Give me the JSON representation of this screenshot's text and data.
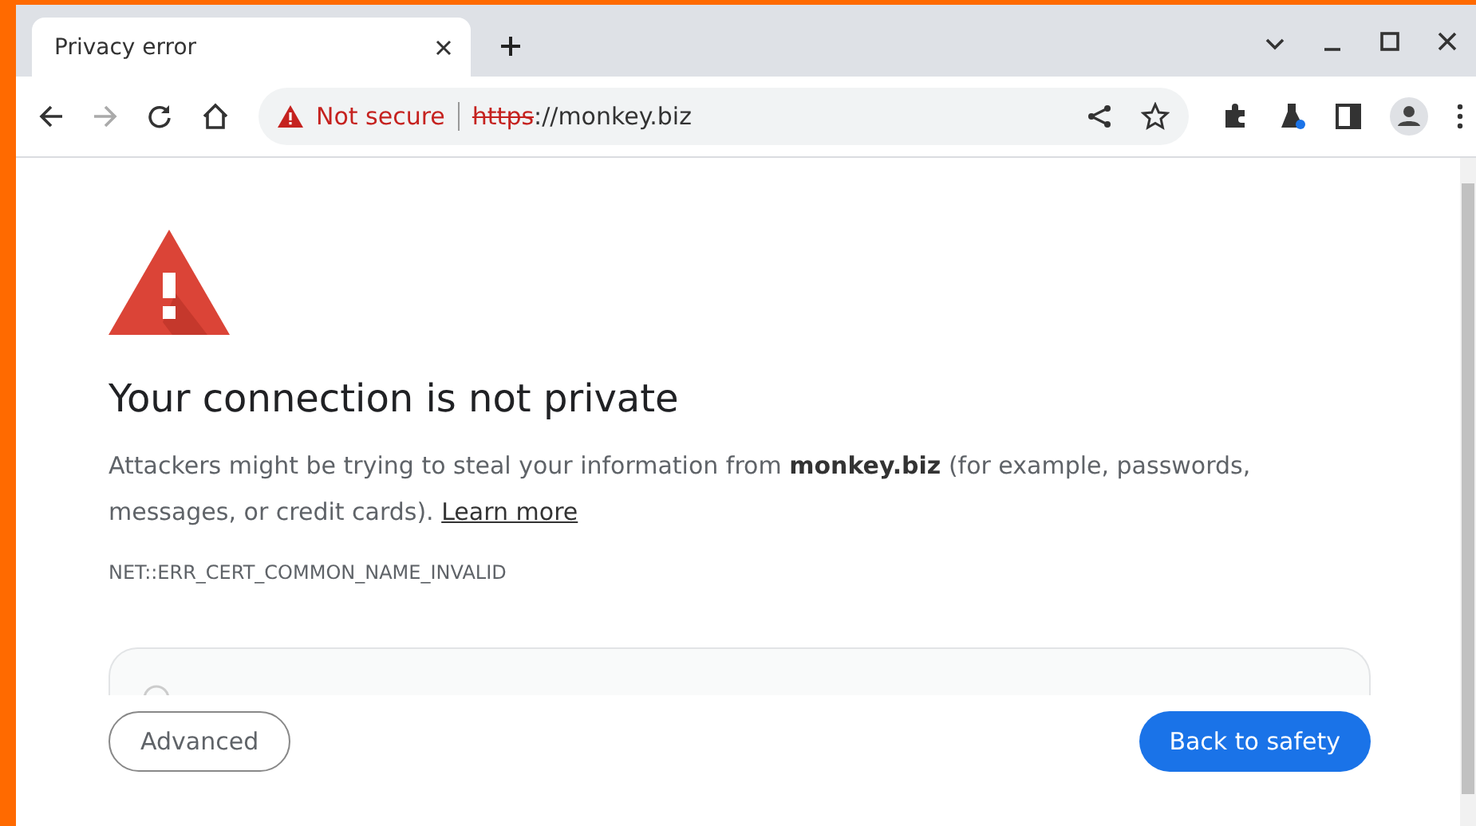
{
  "tab": {
    "title": "Privacy error",
    "selected": true
  },
  "toolbar": {
    "security_label": "Not secure",
    "url_scheme": "https",
    "url_rest": "://monkey.biz",
    "forward_disabled": true
  },
  "page": {
    "heading": "Your connection is not private",
    "message": "Attackers might be trying to steal your information from **monkey.biz** (for example, passwords, messages, or credit cards). ",
    "link": "Learn more",
    "error_code": "NET::ERR_CERT_COMMON_NAME_INVALID",
    "buttons": [
      {
        "label": "Advanced",
        "kind": "secondary"
      },
      {
        "label": "Back to safety",
        "kind": "primary"
      }
    ]
  }
}
